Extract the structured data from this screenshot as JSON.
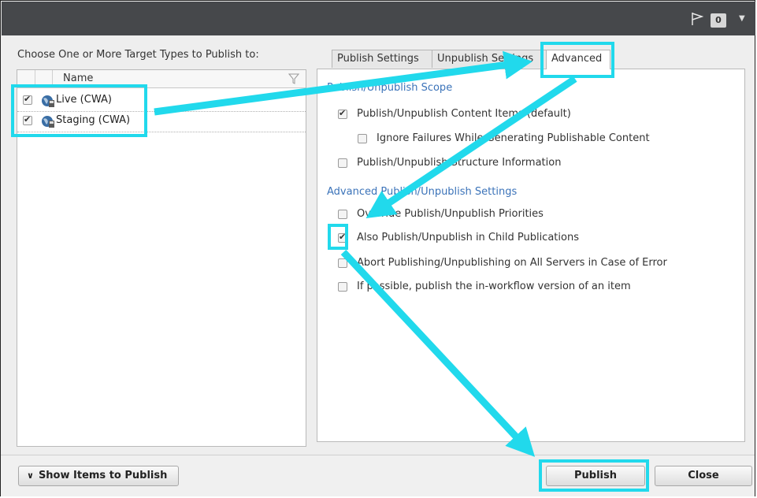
{
  "header": {
    "notification_count": "0"
  },
  "left": {
    "label": "Choose One or More Target Types to Publish to:",
    "column_name": "Name",
    "targets": [
      {
        "label": "Live (CWA)",
        "checked": true
      },
      {
        "label": "Staging (CWA)",
        "checked": true
      }
    ]
  },
  "tabs": [
    {
      "label": "Publish Settings"
    },
    {
      "label": "Unpublish Settings"
    },
    {
      "label": "Advanced"
    }
  ],
  "advanced": {
    "scope_heading": "Publish/Unpublish Scope",
    "scope_options": [
      {
        "label": "Publish/Unpublish Content Items (default)",
        "checked": true
      },
      {
        "label": "Ignore Failures While Generating Publishable Content",
        "checked": false
      },
      {
        "label": "Publish/Unpublish Structure Information",
        "checked": false
      }
    ],
    "settings_heading": "Advanced Publish/Unpublish Settings",
    "settings_options": [
      {
        "label": "Override Publish/Unpublish Priorities",
        "checked": false
      },
      {
        "label": "Also Publish/Unpublish in Child Publications",
        "checked": true
      },
      {
        "label": "Abort Publishing/Unpublishing on All Servers in Case of Error",
        "checked": false
      },
      {
        "label": "If possible, publish the in-workflow version of an item",
        "checked": false
      }
    ]
  },
  "footer": {
    "show_items_label": "Show Items to Publish",
    "publish_label": "Publish",
    "close_label": "Close"
  },
  "colors": {
    "highlight": "#21d9ec",
    "section_heading": "#3b73b9",
    "topbar": "#46484b"
  }
}
